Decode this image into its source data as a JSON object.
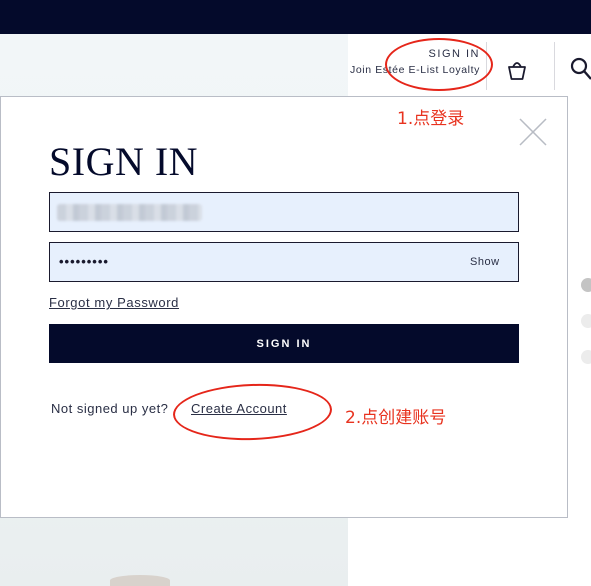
{
  "header": {
    "signin_label": "SIGN IN",
    "loyalty_label": "Join Estée E-List Loyalty",
    "bag_icon": "shopping-bag-icon",
    "search_icon": "search-icon"
  },
  "modal": {
    "title": "SIGN IN",
    "close_icon": "close-icon",
    "email": {
      "value": "",
      "placeholder": ""
    },
    "password": {
      "masked_value": "•••••••••",
      "show_label": "Show"
    },
    "forgot_label": "Forgot my Password",
    "signin_button_label": "SIGN IN",
    "not_signed_label": "Not signed up yet?",
    "create_account_label": "Create Account"
  },
  "annotations": {
    "step1": "1.点登录",
    "step2": "2.点创建账号",
    "color": "#e8331f"
  },
  "colors": {
    "brand_navy": "#040a2b",
    "input_bg": "#e7f0fd"
  }
}
